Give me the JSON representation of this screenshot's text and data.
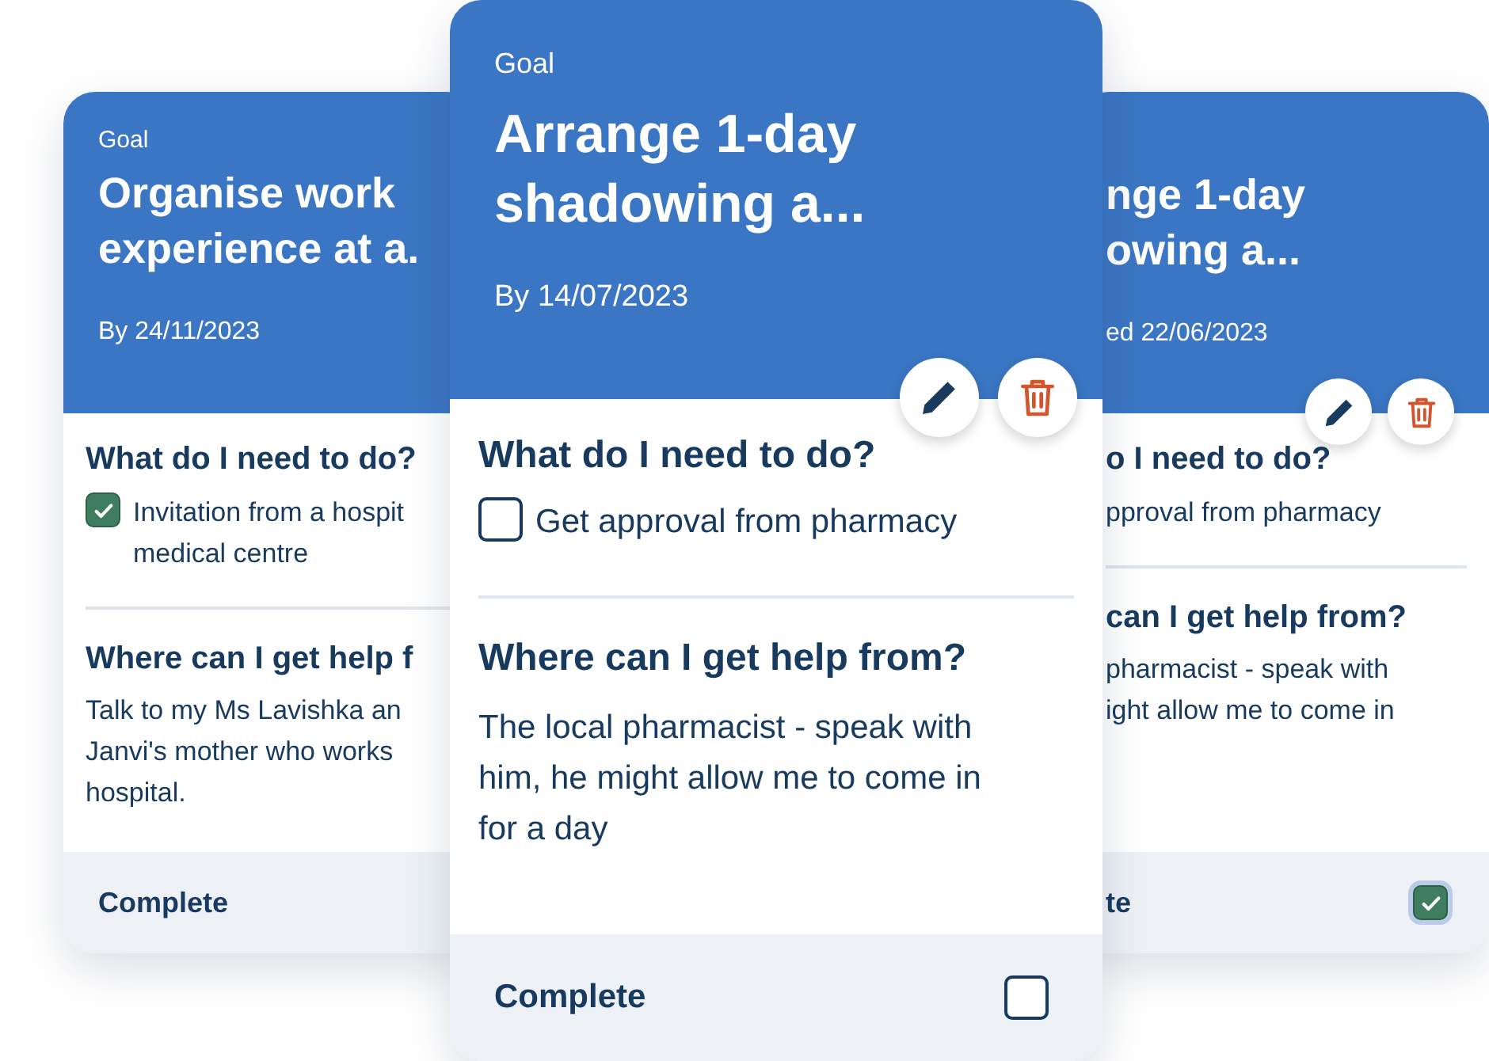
{
  "cards": [
    {
      "kind": "back",
      "eyebrow": "Goal",
      "title_lines": [
        "Organise work",
        "experience at a."
      ],
      "date": "By 24/11/2023",
      "todo_heading": "What do I need to do?",
      "tasks": [
        {
          "lines": [
            "Invitation from a hospit",
            "medical centre"
          ],
          "checked": true
        }
      ],
      "help_heading": "Where can I get help f",
      "help_lines": [
        "Talk to my Ms Lavishka an",
        "Janvi's mother who works",
        "hospital."
      ],
      "footer_label": "Complete"
    },
    {
      "kind": "front",
      "eyebrow": "Goal",
      "title_lines": [
        "Arrange 1-day",
        "shadowing a..."
      ],
      "date": "By 14/07/2023",
      "actions": [
        {
          "kind": "edit"
        },
        {
          "kind": "delete"
        }
      ],
      "todo_heading": "What do I need to do?",
      "tasks": [
        {
          "lines": [
            "Get approval from pharmacy"
          ],
          "checked": false
        }
      ],
      "help_heading": "Where can I get help from?",
      "help_lines": [
        "The local pharmacist - speak with",
        "him, he might allow me to come in",
        "for a day"
      ],
      "footer_label": "Complete",
      "complete": false
    },
    {
      "kind": "back",
      "title_lines": [
        "nge 1-day",
        "owing a..."
      ],
      "date": "ed 22/06/2023",
      "actions": [
        {
          "kind": "edit"
        },
        {
          "kind": "delete"
        }
      ],
      "todo_heading": "o I need to do?",
      "tasks": [
        {
          "lines": [
            "pproval from pharmacy"
          ]
        }
      ],
      "help_heading": "can I get help from?",
      "help_lines": [
        "pharmacist - speak with",
        "ight allow me to come in"
      ],
      "footer_label": "te",
      "complete": true
    }
  ]
}
